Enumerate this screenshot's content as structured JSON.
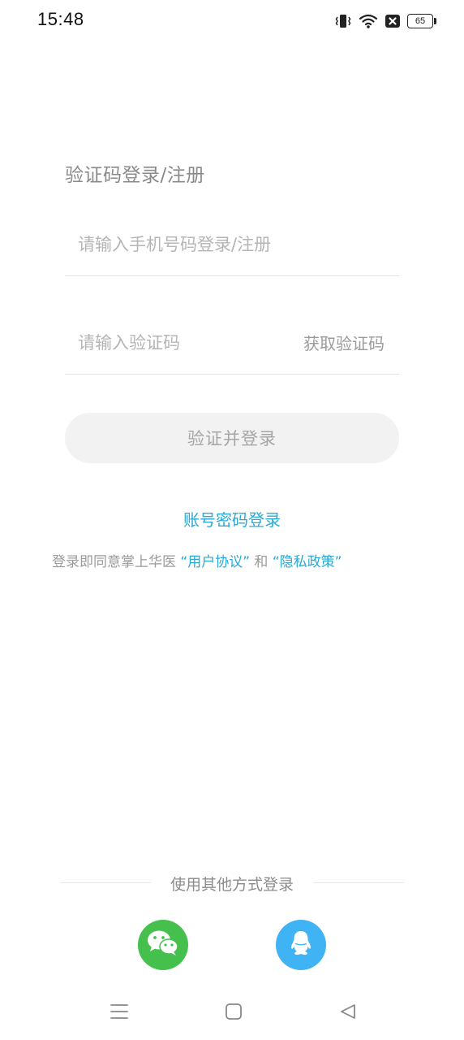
{
  "status_bar": {
    "time": "15:48",
    "battery_level": "65",
    "icons": [
      "vibrate-icon",
      "wifi-icon",
      "no-sim-icon",
      "battery-icon"
    ]
  },
  "login": {
    "title": "验证码登录/注册",
    "phone_placeholder": "请输入手机号码登录/注册",
    "phone_value": "",
    "code_placeholder": "请输入验证码",
    "code_value": "",
    "get_code_label": "获取验证码",
    "submit_label": "验证并登录",
    "password_login_label": "账号密码登录"
  },
  "agreement": {
    "prefix": "登录即同意掌上华医 ",
    "user_agreement": "“用户协议”",
    "conjunction": " 和 ",
    "privacy_policy": "“隐私政策”"
  },
  "other_login": {
    "label": "使用其他方式登录",
    "providers": [
      "wechat-icon",
      "qq-icon"
    ]
  },
  "nav_bar": {
    "buttons": [
      "menu-icon",
      "home-icon",
      "back-icon"
    ]
  },
  "colors": {
    "link": "#29a9d6",
    "wechat": "#45c04c",
    "qq": "#3fb3f3",
    "button_bg": "#f2f2f2"
  }
}
